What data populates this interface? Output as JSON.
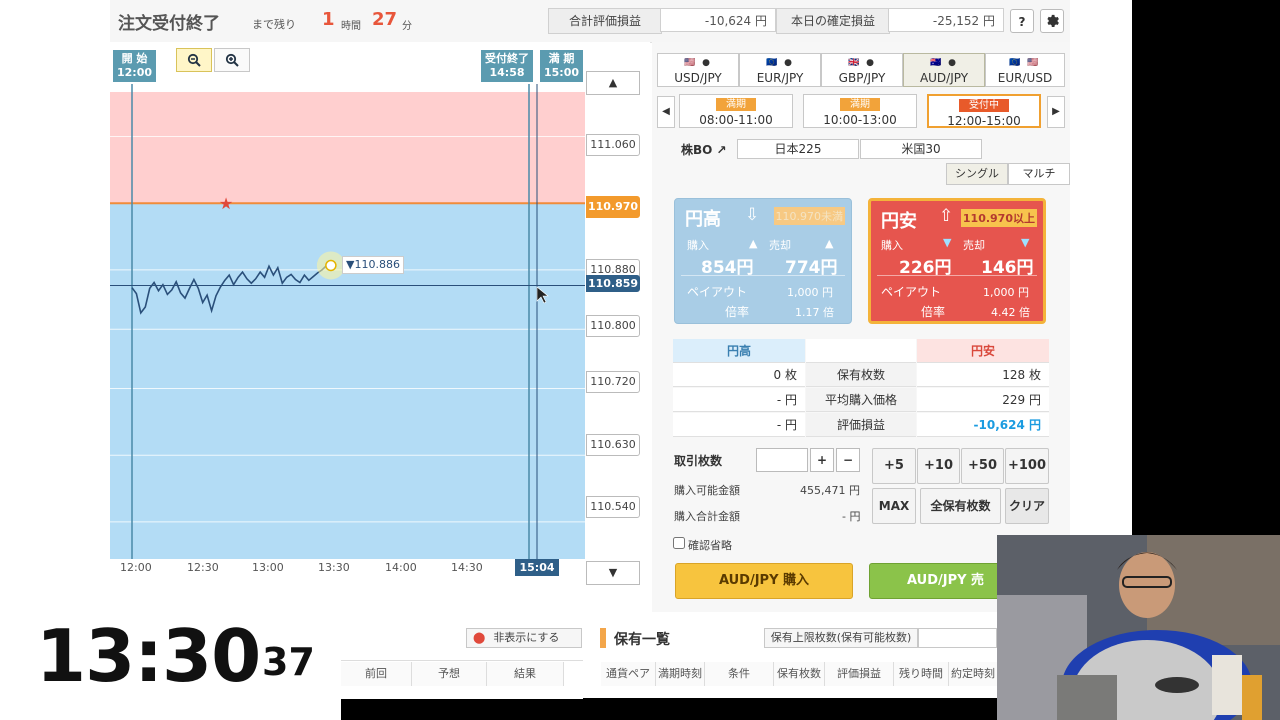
{
  "header": {
    "status_title": "注文受付終了",
    "remaining_label": "まで残り",
    "hours": "1",
    "hours_unit": "時間",
    "minutes": "27",
    "minutes_unit": "分",
    "total_pl_label": "合計評価損益",
    "total_pl_value": "-10,624 円",
    "today_pl_label": "本日の確定損益",
    "today_pl_value": "-25,152 円",
    "help_label": "?",
    "settings_icon": "gear-icon"
  },
  "chart": {
    "start_flag": [
      "開 始",
      "12:00"
    ],
    "close_flag": [
      "受付終了",
      "14:58"
    ],
    "expiry_flag": [
      "満 期",
      "15:00"
    ],
    "zoom_out_icon": "zoom-out-icon",
    "zoom_in_icon": "zoom-in-icon",
    "current_time_tag": "15:04",
    "current_price_label": "▼110.886",
    "colors": {
      "above": "#ffcfcf",
      "below": "#b3dcf5",
      "strike": "#f08c3a",
      "line": "#2a4f7a"
    }
  },
  "chart_data": {
    "type": "line",
    "xlabel": "",
    "ylabel": "",
    "x_ticks": [
      "12:00",
      "12:30",
      "13:00",
      "13:30",
      "14:00",
      "14:30"
    ],
    "y_ticks": [
      "111.060",
      "110.970",
      "110.880",
      "110.859",
      "110.800",
      "110.720",
      "110.630",
      "110.540"
    ],
    "ylim": [
      110.49,
      111.12
    ],
    "xlim_minutes": [
      0,
      205
    ],
    "strike": 110.97,
    "current": 110.859,
    "series": [
      {
        "x": [
          0,
          2,
          4,
          6,
          8,
          10,
          12,
          14,
          16,
          18,
          20,
          22,
          24,
          26,
          28,
          30,
          32,
          34,
          36,
          38,
          40,
          42,
          44,
          46,
          48,
          50,
          52,
          54,
          56,
          58,
          60,
          62,
          64,
          66,
          68,
          70,
          72,
          74,
          76,
          78,
          80,
          82,
          84,
          86,
          88,
          90
        ],
        "values": [
          110.856,
          110.848,
          110.822,
          110.83,
          110.855,
          110.863,
          110.852,
          110.86,
          110.847,
          110.853,
          110.864,
          110.849,
          110.842,
          110.855,
          110.867,
          110.855,
          110.836,
          110.846,
          110.825,
          110.845,
          110.857,
          110.866,
          110.873,
          110.86,
          110.87,
          110.877,
          110.868,
          110.862,
          110.868,
          110.877,
          110.87,
          110.885,
          110.873,
          110.883,
          110.862,
          110.87,
          110.874,
          110.867,
          110.863,
          110.873,
          110.866,
          110.871,
          110.876,
          110.88,
          110.886,
          110.886
        ]
      }
    ]
  },
  "price_axis": {
    "up_arrow": "▲",
    "down_arrow": "▼",
    "tags": [
      "111.060",
      "110.970",
      "110.880",
      "110.859",
      "110.800",
      "110.720",
      "110.630",
      "110.540"
    ]
  },
  "pairs": [
    {
      "label": "USD/JPY",
      "flags": "🇺🇸 ●"
    },
    {
      "label": "EUR/JPY",
      "flags": "🇪🇺 ●"
    },
    {
      "label": "GBP/JPY",
      "flags": "🇬🇧 ●"
    },
    {
      "label": "AUD/JPY",
      "flags": "🇦🇺 ●"
    },
    {
      "label": "EUR/USD",
      "flags": "🇪🇺 🇺🇸"
    }
  ],
  "time_slots": [
    {
      "badge": "満期",
      "time": "08:00-11:00"
    },
    {
      "badge": "満期",
      "time": "10:00-13:00"
    },
    {
      "badge": "受付中",
      "time": "12:00-15:00"
    }
  ],
  "stock": {
    "label": "株BO ↗",
    "items": [
      "日本225",
      "米国30"
    ]
  },
  "modes": [
    "シングル",
    "マルチ"
  ],
  "card_high": {
    "dir": "円高",
    "cond": "110.970未満",
    "buy_label": "購入",
    "sell_label": "売却",
    "buy_price": "854円",
    "sell_price": "774円",
    "payout_label": "ペイアウト",
    "payout_value": "1,000 円",
    "ratio_label": "倍率",
    "ratio_value": "1.17 倍"
  },
  "card_low": {
    "dir": "円安",
    "cond": "110.970以上",
    "buy_label": "購入",
    "sell_label": "売却",
    "buy_price": "226円",
    "sell_price": "146円",
    "payout_label": "ペイアウト",
    "payout_value": "1,000 円",
    "ratio_label": "倍率",
    "ratio_value": "4.42 倍"
  },
  "summary": {
    "col_high": "円高",
    "col_low": "円安",
    "rows": [
      {
        "label": "保有枚数",
        "high": "0 枚",
        "low": "128 枚"
      },
      {
        "label": "平均購入価格",
        "high": "- 円",
        "low": "229 円"
      },
      {
        "label": "評価損益",
        "high": "- 円",
        "low": "-10,624 円"
      }
    ]
  },
  "trade": {
    "qty_label": "取引枚数",
    "plus": "+",
    "minus": "−",
    "quick": [
      "+5",
      "+10",
      "+50",
      "+100"
    ],
    "max": "MAX",
    "all": "全保有枚数",
    "clear": "クリア",
    "avail_label": "購入可能金額",
    "avail_value": "455,471 円",
    "total_label": "購入合計金額",
    "total_value": "- 円",
    "confirm_label": "確認省略",
    "buy_button": "AUD/JPY 購入",
    "sell_button": "AUD/JPY 売"
  },
  "bottom": {
    "clock_main": "13:30",
    "clock_sec": "37",
    "hide_button": "非表示にする",
    "history_headers": [
      "前回",
      "予想",
      "結果"
    ],
    "holdings_title": "保有一覧",
    "holdings_limit": "保有上限枚数(保有可能枚数)",
    "holdings_headers": [
      "通貨ペア",
      "満期時刻",
      "条件",
      "保有枚数",
      "評価損益",
      "残り時間",
      "約定時刻"
    ]
  }
}
